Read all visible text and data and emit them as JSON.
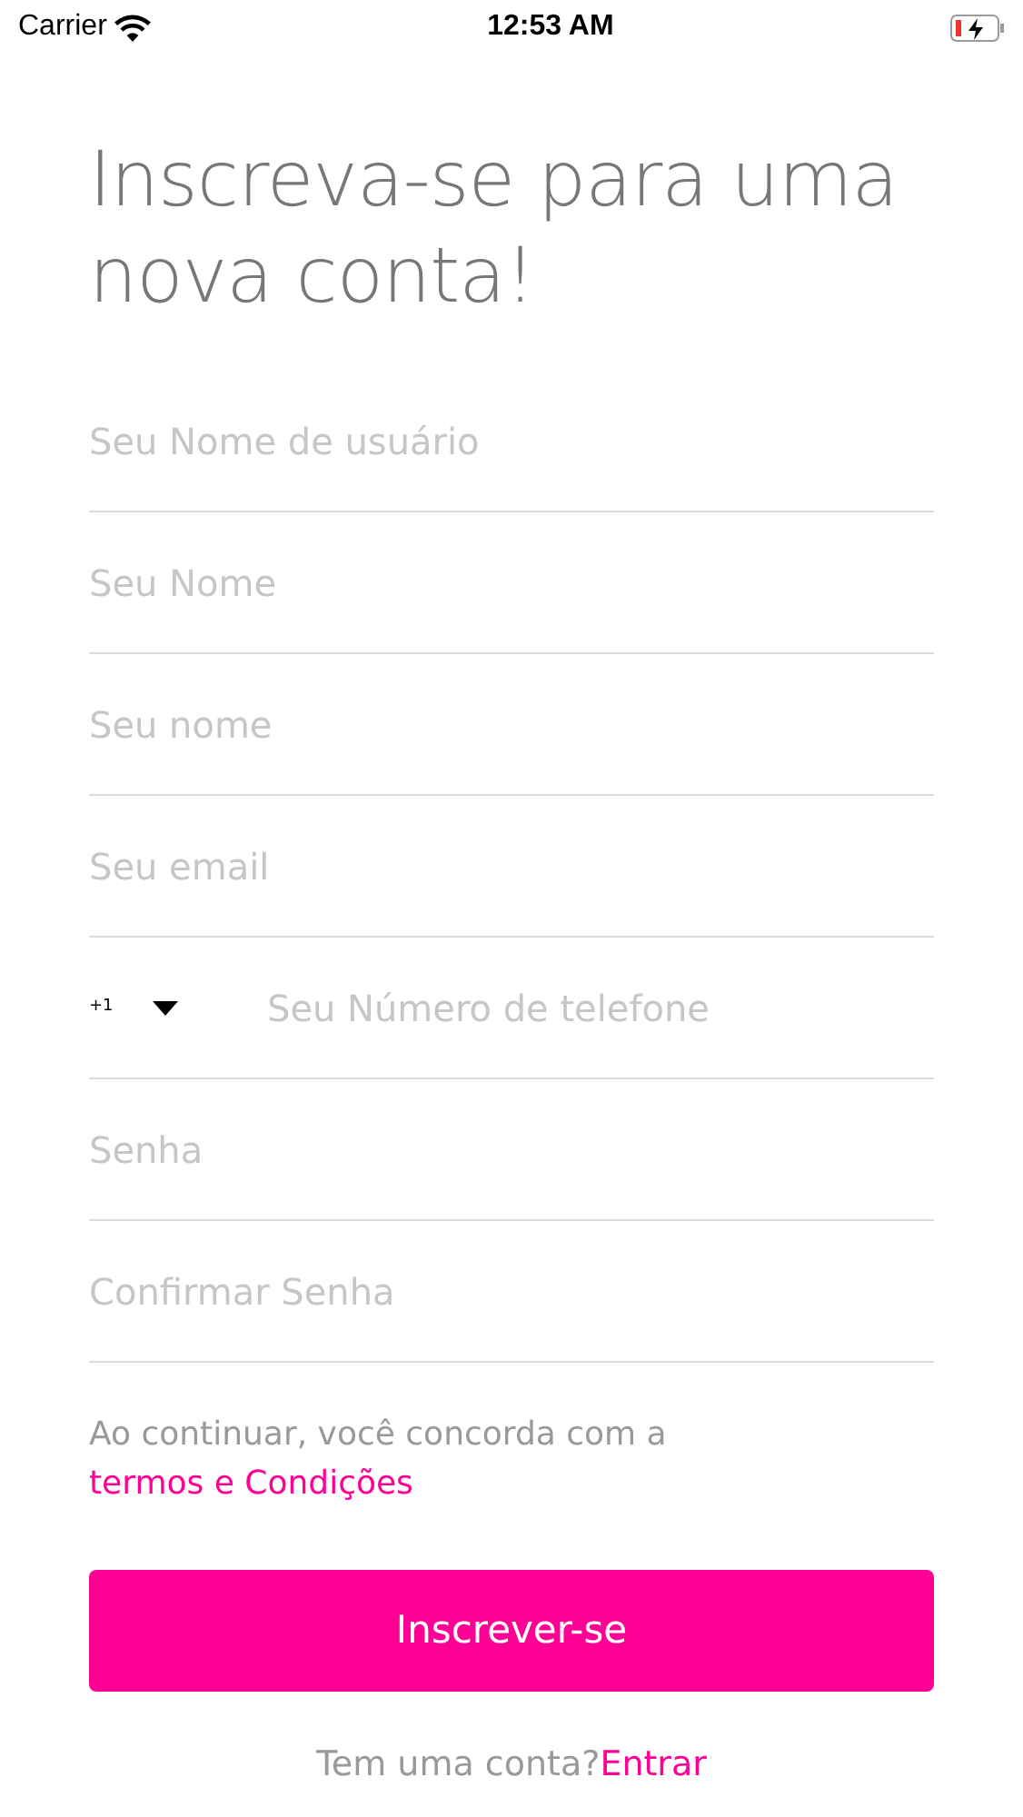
{
  "status_bar": {
    "carrier": "Carrier",
    "time": "12:53 AM"
  },
  "title": "Inscreva-se para uma nova conta!",
  "fields": [
    {
      "kind": "text",
      "placeholder": "Seu Nome de usuário"
    },
    {
      "kind": "text",
      "placeholder": "Seu Nome"
    },
    {
      "kind": "text",
      "placeholder": "Seu nome"
    },
    {
      "kind": "text",
      "placeholder": "Seu email"
    },
    {
      "kind": "phone",
      "country_code": "+1",
      "placeholder": "Seu Número de telefone"
    },
    {
      "kind": "password",
      "placeholder": "Senha"
    },
    {
      "kind": "password",
      "placeholder": "Confirmar Senha"
    }
  ],
  "terms": {
    "text": "Ao continuar, você concorda com a",
    "link": "termos e Condições"
  },
  "submit_button": "Inscrever-se",
  "login": {
    "text": "Tem uma conta?",
    "link": "Entrar"
  }
}
